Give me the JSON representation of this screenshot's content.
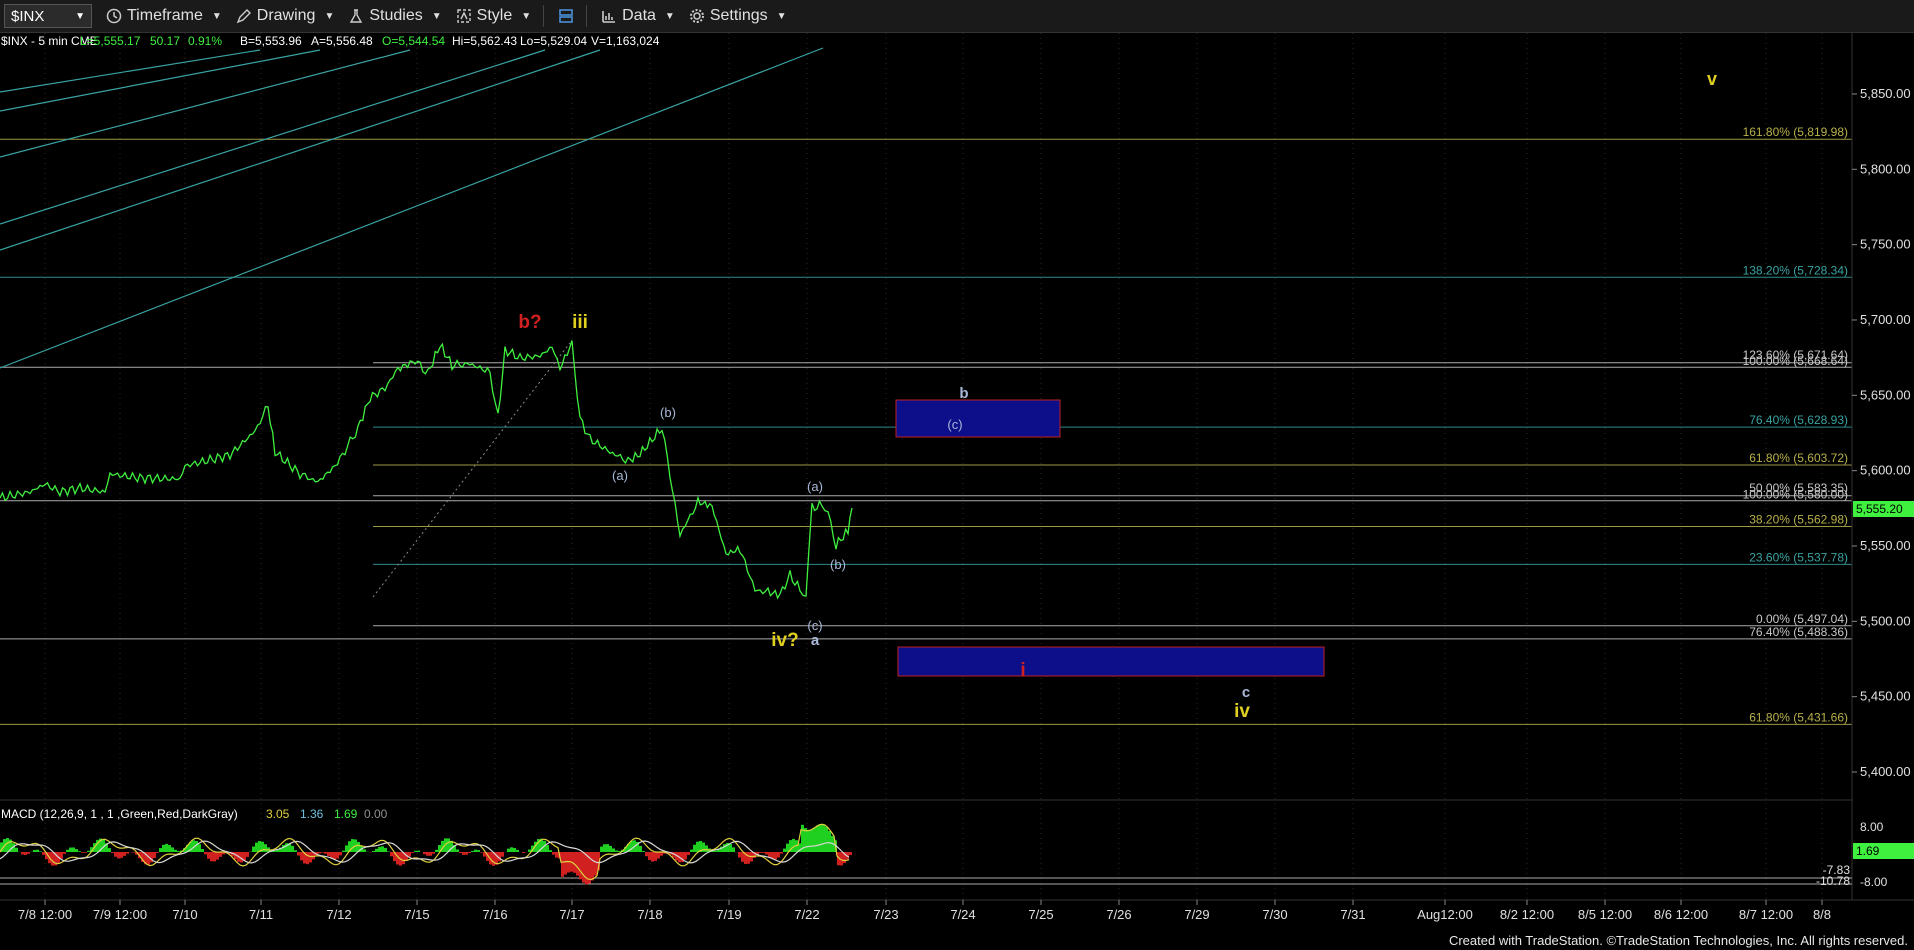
{
  "toolbar": {
    "symbol": "$INX",
    "menus": [
      "Timeframe",
      "Drawing",
      "Studies",
      "Style",
      "Data",
      "Settings"
    ]
  },
  "header": {
    "text": "$INX - 5 min  CME",
    "fields": [
      {
        "label": "L=5,555.17",
        "color": "#3ff03f"
      },
      {
        "label": "50.17",
        "color": "#3ff03f"
      },
      {
        "label": "0.91%",
        "color": "#3ff03f"
      },
      {
        "label": "B=5,553.96",
        "color": "#ffffff"
      },
      {
        "label": "A=5,556.48",
        "color": "#ffffff"
      },
      {
        "label": "O=5,544.54",
        "color": "#3ff03f"
      },
      {
        "label": "Hi=5,562.43",
        "color": "#ffffff"
      },
      {
        "label": "Lo=5,529.04",
        "color": "#ffffff"
      },
      {
        "label": "V=1,163,024",
        "color": "#ffffff"
      }
    ]
  },
  "price_axis": [
    "5,850.00",
    "5,800.00",
    "5,750.00",
    "5,700.00",
    "5,650.00",
    "5,600.00",
    "5,550.00",
    "5,500.00",
    "5,450.00",
    "5,400.00"
  ],
  "last_price": "5,555.20",
  "fib_labels": [
    {
      "text": "161.80% (5,819.98)",
      "price": 5819.98,
      "color": "#b8b14a"
    },
    {
      "text": "138.20% (5,728.34)",
      "price": 5728.34,
      "color": "#3aa3a3"
    },
    {
      "text": "123.60% (5,671.64)",
      "price": 5671.64,
      "color": "#c8c8c8"
    },
    {
      "text": "100.00% (5,668.64)",
      "price": 5668.64,
      "color": "#c8c8c8"
    },
    {
      "text": "76.40% (5,628.93)",
      "price": 5628.93,
      "color": "#3aa3a3"
    },
    {
      "text": "61.80% (5,603.72)",
      "price": 5603.72,
      "color": "#b8b14a"
    },
    {
      "text": "50.00% (5,583.35)",
      "price": 5583.35,
      "color": "#c8c8c8"
    },
    {
      "text": "100.00% (5,580.00)",
      "price": 5580.0,
      "color": "#c8c8c8"
    },
    {
      "text": "38.20% (5,562.98)",
      "price": 5562.98,
      "color": "#b8b14a"
    },
    {
      "text": "23.60% (5,537.78)",
      "price": 5537.78,
      "color": "#3aa3a3"
    },
    {
      "text": "0.00% (5,497.04)",
      "price": 5497.04,
      "color": "#c8c8c8"
    },
    {
      "text": "76.40% (5,488.36)",
      "price": 5488.36,
      "color": "#c8c8c8"
    },
    {
      "text": "61.80% (5,431.66)",
      "price": 5431.66,
      "color": "#b8b14a"
    }
  ],
  "wave_labels": [
    {
      "text": "v",
      "color": "#e0d020",
      "bold": true
    },
    {
      "text": "b?",
      "color": "#d02020",
      "bold": true
    },
    {
      "text": "iii",
      "color": "#e0d020",
      "bold": true
    },
    {
      "text": "(b)",
      "color": "#a8b8d8"
    },
    {
      "text": "(a)",
      "color": "#a8b8d8"
    },
    {
      "text": "(a)",
      "color": "#a8b8d8"
    },
    {
      "text": "(b)",
      "color": "#a8b8d8"
    },
    {
      "text": "(c)",
      "color": "#a8b8d8"
    },
    {
      "text": "iv?",
      "color": "#e0d020",
      "bold": true
    },
    {
      "text": "a",
      "color": "#a8b8d8",
      "bold": true
    },
    {
      "text": "b",
      "color": "#a8b8d8",
      "bold": true
    },
    {
      "text": "(c)",
      "color": "#a8b8d8"
    },
    {
      "text": "i",
      "color": "#d02020",
      "bold": true
    },
    {
      "text": "c",
      "color": "#a8b8d8",
      "bold": true
    },
    {
      "text": "iv",
      "color": "#e0d020",
      "bold": true
    }
  ],
  "macd": {
    "title": "MACD (12,26,9, 1 , 1 ,Green,Red,DarkGray)",
    "values": [
      {
        "label": "3.05",
        "color": "#e0d040"
      },
      {
        "label": "1.36",
        "color": "#70c0e0"
      },
      {
        "label": "1.69",
        "color": "#3ff03f"
      },
      {
        "label": "0.00",
        "color": "#909090"
      }
    ],
    "axis": [
      "8.00",
      "-7.83",
      "-10.78",
      "-8.00"
    ],
    "last": "1.69"
  },
  "time_axis": [
    "7/8 12:00",
    "7/9 12:00",
    "7/10",
    "7/11",
    "7/12",
    "7/15",
    "7/16",
    "7/17",
    "7/18",
    "7/19",
    "7/22",
    "7/23",
    "7/24",
    "7/25",
    "7/26",
    "7/29",
    "7/30",
    "7/31",
    "Aug12:00",
    "8/2 12:00",
    "8/5 12:00",
    "8/6 12:00",
    "8/7 12:00",
    "8/8"
  ],
  "footer": "Created with TradeStation. ©TradeStation Technologies, Inc. All rights reserved."
}
